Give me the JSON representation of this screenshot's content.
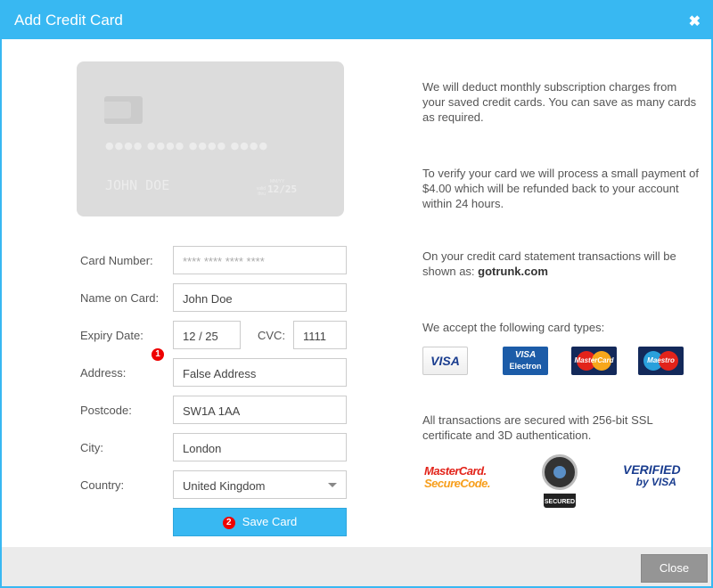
{
  "dialog": {
    "title": "Add Credit Card",
    "close_icon": "close-icon"
  },
  "card_preview": {
    "number_mask": "●●●● ●●●● ●●●● ●●●●",
    "name": "JOHN DOE",
    "expiry_caption": "MM/YY",
    "valid_label": "valid thru",
    "expiry": "12/25"
  },
  "form": {
    "card_number": {
      "label": "Card Number:",
      "placeholder": "**** **** **** ****",
      "value": ""
    },
    "name_on_card": {
      "label": "Name on Card:",
      "value": "John Doe"
    },
    "expiry_date": {
      "label": "Expiry Date:",
      "value": "12 / 25"
    },
    "cvc": {
      "label": "CVC:",
      "value": "1111"
    },
    "address": {
      "label": "Address:",
      "value": "False Address"
    },
    "postcode": {
      "label": "Postcode:",
      "value": "SW1A 1AA"
    },
    "city": {
      "label": "City:",
      "value": "London"
    },
    "country": {
      "label": "Country:",
      "value": "United Kingdom"
    },
    "save_button": "Save Card",
    "markers": {
      "first": "1",
      "second": "2"
    }
  },
  "info": {
    "p1": "We will deduct monthly subscription charges from your saved credit cards. You can save as many cards as required.",
    "p2": "To verify your card we will process a small payment of $4.00 which will be refunded back to your account within 24 hours.",
    "p3_prefix": "On your credit card statement transactions will be shown as: ",
    "p3_domain": "gotrunk.com",
    "p4": "We accept the following card types:",
    "p5": "All transactions are secured with 256-bit SSL certificate and 3D authentication."
  },
  "card_types": {
    "visa": "VISA",
    "visa_electron_top": "VISA",
    "visa_electron_bottom": "Electron",
    "mastercard": "MasterCard",
    "maestro": "Maestro"
  },
  "security_badges": {
    "mc_securecode_l1": "MasterCard.",
    "mc_securecode_l2": "SecureCode.",
    "secured": "SECURED",
    "vbv_l1": "VERIFIED",
    "vbv_l2": "by VISA"
  },
  "footer": {
    "close_button": "Close"
  },
  "colors": {
    "accent": "#38b8f2",
    "marker": "#ee0000",
    "close_button": "#959595"
  }
}
